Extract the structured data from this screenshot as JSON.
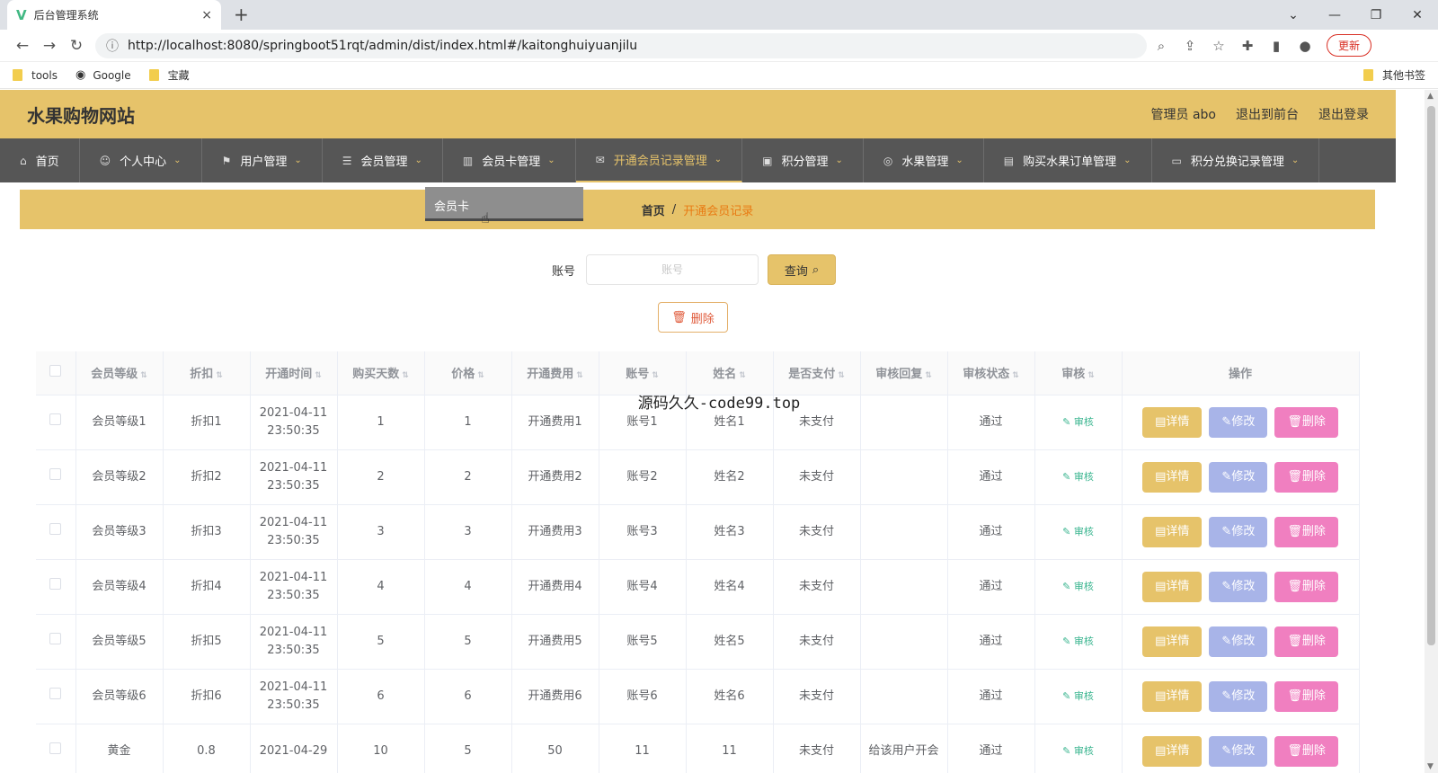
{
  "browser": {
    "tab_title": "后台管理系统",
    "tab_close": "×",
    "new_tab": "+",
    "url": "http://localhost:8080/springboot51rqt/admin/dist/index.html#/kaitonghuiyuanjilu",
    "update_label": "更新",
    "bookmarks": [
      {
        "label": "tools",
        "icon": "folder-icon"
      },
      {
        "label": "Google",
        "icon": "globe-icon"
      },
      {
        "label": "宝藏",
        "icon": "folder-icon"
      }
    ],
    "other_bookmarks": "其他书签"
  },
  "header": {
    "site_title": "水果购物网站",
    "user_label": "管理员 abo",
    "to_front": "退出到前台",
    "logout": "退出登录"
  },
  "menu": [
    {
      "label": "首页",
      "icon": "home-icon",
      "dropdown": false
    },
    {
      "label": "个人中心",
      "icon": "user-icon",
      "dropdown": true
    },
    {
      "label": "用户管理",
      "icon": "flag-icon",
      "dropdown": true
    },
    {
      "label": "会员管理",
      "icon": "list-icon",
      "dropdown": true
    },
    {
      "label": "会员卡管理",
      "icon": "bar-chart-icon",
      "dropdown": true
    },
    {
      "label": "开通会员记录管理",
      "icon": "mail-icon",
      "dropdown": true,
      "active": true
    },
    {
      "label": "积分管理",
      "icon": "bag-icon",
      "dropdown": true
    },
    {
      "label": "水果管理",
      "icon": "disc-icon",
      "dropdown": true
    },
    {
      "label": "购买水果订单管理",
      "icon": "chat-icon",
      "dropdown": true
    },
    {
      "label": "积分兑换记录管理",
      "icon": "card-icon",
      "dropdown": true
    }
  ],
  "dropdown_item": "会员卡",
  "breadcrumb": {
    "home": "首页",
    "sep": "/",
    "current": "开通会员记录"
  },
  "search": {
    "label": "账号",
    "placeholder": "账号",
    "button": "查询"
  },
  "batch_delete": "删除",
  "table": {
    "headers": [
      "会员等级",
      "折扣",
      "开通时间",
      "购买天数",
      "价格",
      "开通费用",
      "账号",
      "姓名",
      "是否支付",
      "审核回复",
      "审核状态",
      "审核",
      "操作"
    ],
    "rows": [
      [
        "会员等级1",
        "折扣1",
        "2021-04-11",
        "23:50:35",
        "1",
        "1",
        "开通费用1",
        "账号1",
        "姓名1",
        "未支付",
        "",
        "通过"
      ],
      [
        "会员等级2",
        "折扣2",
        "2021-04-11",
        "23:50:35",
        "2",
        "2",
        "开通费用2",
        "账号2",
        "姓名2",
        "未支付",
        "",
        "通过"
      ],
      [
        "会员等级3",
        "折扣3",
        "2021-04-11",
        "23:50:35",
        "3",
        "3",
        "开通费用3",
        "账号3",
        "姓名3",
        "未支付",
        "",
        "通过"
      ],
      [
        "会员等级4",
        "折扣4",
        "2021-04-11",
        "23:50:35",
        "4",
        "4",
        "开通费用4",
        "账号4",
        "姓名4",
        "未支付",
        "",
        "通过"
      ],
      [
        "会员等级5",
        "折扣5",
        "2021-04-11",
        "23:50:35",
        "5",
        "5",
        "开通费用5",
        "账号5",
        "姓名5",
        "未支付",
        "",
        "通过"
      ],
      [
        "会员等级6",
        "折扣6",
        "2021-04-11",
        "23:50:35",
        "6",
        "6",
        "开通费用6",
        "账号6",
        "姓名6",
        "未支付",
        "",
        "通过"
      ],
      [
        "黄金",
        "0.8",
        "2021-04-29",
        "",
        "10",
        "5",
        "50",
        "11",
        "11",
        "未支付",
        "给该用户开会",
        "通过"
      ]
    ],
    "audit_label": "审核",
    "op_detail": "详情",
    "op_edit": "修改",
    "op_delete": "删除"
  },
  "watermark": "源码久久-code99.top"
}
